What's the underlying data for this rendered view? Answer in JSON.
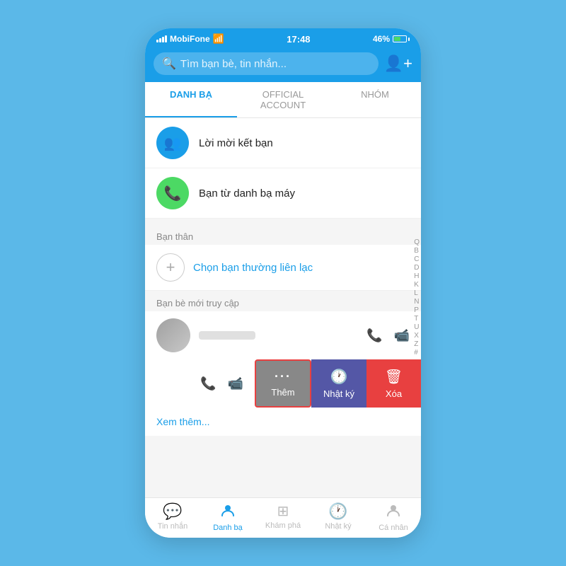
{
  "statusBar": {
    "carrier": "MobiFone",
    "time": "17:48",
    "battery": "46%",
    "wifi": true
  },
  "searchBar": {
    "placeholder": "Tìm bạn bè, tin nhắn...",
    "addFriendIcon": "person-add-icon"
  },
  "tabs": [
    {
      "id": "danh-ba",
      "label": "DANH BẠ",
      "active": true
    },
    {
      "id": "official-account",
      "label": "OFFICIAL ACCOUNT",
      "active": false
    },
    {
      "id": "nhom",
      "label": "NHÓM",
      "active": false
    }
  ],
  "contactItems": [
    {
      "id": "loi-moi-ket-ban",
      "icon": "👥",
      "iconBg": "blue",
      "label": "Lời mời kết bạn"
    },
    {
      "id": "ban-tu-danh-ba",
      "icon": "📞",
      "iconBg": "green",
      "label": "Bạn từ danh bạ máy"
    }
  ],
  "banThanSection": {
    "header": "Bạn thân",
    "addLabel": "Chọn bạn thường liên lạc"
  },
  "banBeMoiSection": {
    "header": "Bạn bè mới truy cập"
  },
  "friends": [
    {
      "id": "friend-1",
      "name": "••••••",
      "hasSwipe": false
    },
    {
      "id": "friend-2",
      "name": "••••••",
      "hasSwipe": true
    }
  ],
  "swipeActions": [
    {
      "id": "them",
      "label": "Thêm",
      "icon": "···",
      "bg": "gray",
      "highlight": true
    },
    {
      "id": "nhatky",
      "label": "Nhật ký",
      "icon": "🕐",
      "bg": "purple"
    },
    {
      "id": "xoa",
      "label": "Xóa",
      "icon": "🗑",
      "bg": "red"
    }
  ],
  "seeMore": "Xem thêm...",
  "indexLetters": [
    "Q",
    "B",
    "C",
    "D",
    "H",
    "K",
    "L",
    "N",
    "P",
    "T",
    "U",
    "X",
    "Z",
    "#"
  ],
  "bottomNav": [
    {
      "id": "tin-nhan",
      "label": "Tin nhắn",
      "icon": "💬",
      "active": false
    },
    {
      "id": "danh-ba",
      "label": "Danh bạ",
      "icon": "👤",
      "active": true
    },
    {
      "id": "kham-pha",
      "label": "Khám phá",
      "icon": "⊞",
      "active": false
    },
    {
      "id": "nhat-ky",
      "label": "Nhật ký",
      "icon": "🕐",
      "active": false
    },
    {
      "id": "ca-nhan",
      "label": "Cá nhân",
      "icon": "👤",
      "active": false
    }
  ]
}
